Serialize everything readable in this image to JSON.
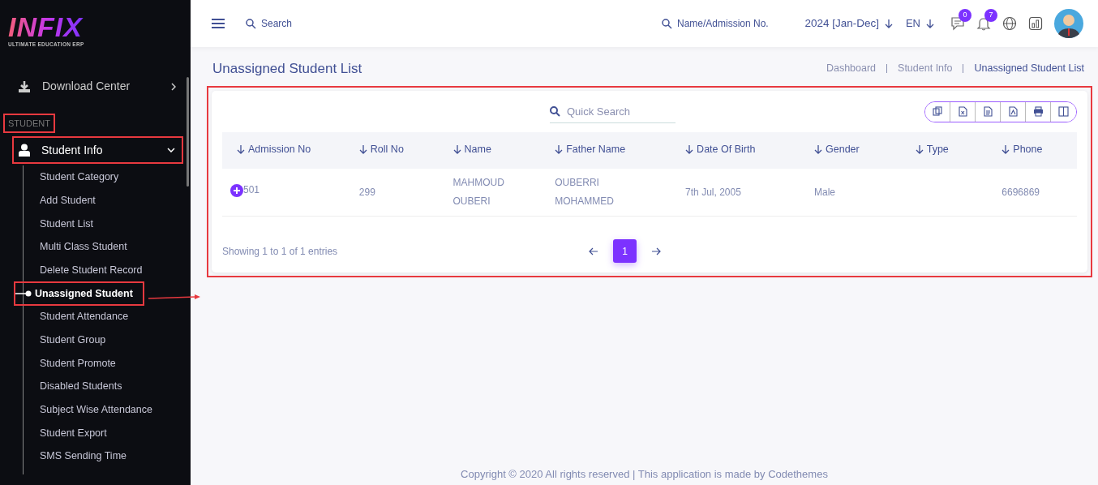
{
  "logo": {
    "text": "INFIX",
    "subtitle": "ULTIMATE EDUCATION ERP"
  },
  "sidebar": {
    "items": [
      {
        "label": "Download Center",
        "kind": "menu"
      }
    ],
    "section": {
      "label": "STUDENT",
      "highlighted": true
    },
    "group": {
      "label": "Student Info",
      "expanded": true,
      "highlighted": true,
      "children": [
        {
          "label": "Student Category",
          "selected": false
        },
        {
          "label": "Add Student",
          "selected": false
        },
        {
          "label": "Student List",
          "selected": false
        },
        {
          "label": "Multi Class Student",
          "selected": false
        },
        {
          "label": "Delete Student Record",
          "selected": false
        },
        {
          "label": "Unassigned Student",
          "selected": true
        },
        {
          "label": "Student Attendance",
          "selected": false
        },
        {
          "label": "Student Group",
          "selected": false
        },
        {
          "label": "Student Promote",
          "selected": false
        },
        {
          "label": "Disabled Students",
          "selected": false
        },
        {
          "label": "Subject Wise Attendance",
          "selected": false
        },
        {
          "label": "Student Export",
          "selected": false
        },
        {
          "label": "SMS Sending Time",
          "selected": false
        }
      ]
    }
  },
  "topbar": {
    "search": {
      "placeholder": "Search"
    },
    "name_search": {
      "placeholder": "Name/Admission No."
    },
    "session": "2024 [Jan-Dec]",
    "language": "EN",
    "messages_count": "0",
    "notifications_count": "7"
  },
  "page_title": "Unassigned Student List",
  "breadcrumb": [
    "Dashboard",
    "Student Info",
    "Unassigned Student List"
  ],
  "table_card": {
    "highlighted": true,
    "quick_search": {
      "placeholder": "Quick Search"
    },
    "columns": [
      "Admission No",
      "Roll No",
      "Name",
      "Father Name",
      "Date Of Birth",
      "Gender",
      "Type",
      "Phone"
    ],
    "rows": [
      {
        "cells": [
          "501",
          "299",
          "MAHMOUD OUBERI",
          "OUBERRI MOHAMMED",
          "7th Jul, 2005",
          "Male",
          "",
          "6696869"
        ]
      }
    ],
    "info": "Showing 1 to 1 of 1 entries",
    "pages": [
      {
        "label": "1",
        "selected": true
      }
    ]
  },
  "footer": "Copyright © 2020 All rights reserved | This application is made by Codethemes"
}
